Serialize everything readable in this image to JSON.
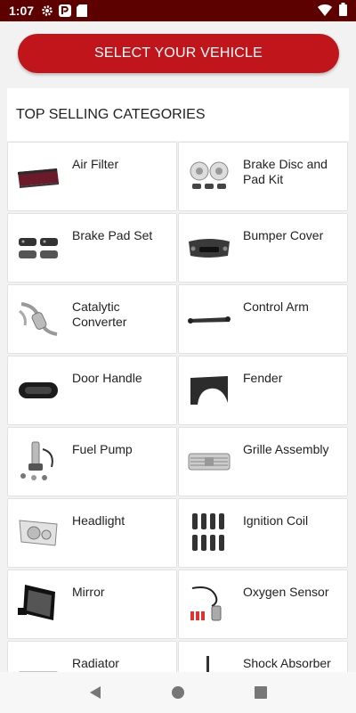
{
  "status_bar": {
    "time": "1:07"
  },
  "actions": {
    "select_vehicle": "SELECT YOUR VEHICLE"
  },
  "categories": {
    "header": "TOP SELLING CATEGORIES",
    "items": [
      {
        "label": "Air Filter",
        "icon": "air-filter-icon"
      },
      {
        "label": "Brake Disc and Pad Kit",
        "icon": "brake-disc-icon"
      },
      {
        "label": "Brake Pad Set",
        "icon": "brake-pad-icon"
      },
      {
        "label": "Bumper Cover",
        "icon": "bumper-cover-icon"
      },
      {
        "label": "Catalytic Converter",
        "icon": "catalytic-converter-icon"
      },
      {
        "label": "Control Arm",
        "icon": "control-arm-icon"
      },
      {
        "label": "Door Handle",
        "icon": "door-handle-icon"
      },
      {
        "label": "Fender",
        "icon": "fender-icon"
      },
      {
        "label": "Fuel Pump",
        "icon": "fuel-pump-icon"
      },
      {
        "label": "Grille Assembly",
        "icon": "grille-icon"
      },
      {
        "label": "Headlight",
        "icon": "headlight-icon"
      },
      {
        "label": "Ignition Coil",
        "icon": "ignition-coil-icon"
      },
      {
        "label": "Mirror",
        "icon": "mirror-icon"
      },
      {
        "label": "Oxygen Sensor",
        "icon": "oxygen-sensor-icon"
      },
      {
        "label": "Radiator",
        "icon": "radiator-icon"
      },
      {
        "label": "Shock Absorber",
        "icon": "shock-absorber-icon"
      }
    ]
  },
  "colors": {
    "brand": "#c0161b",
    "status_bar": "#5c0000"
  }
}
